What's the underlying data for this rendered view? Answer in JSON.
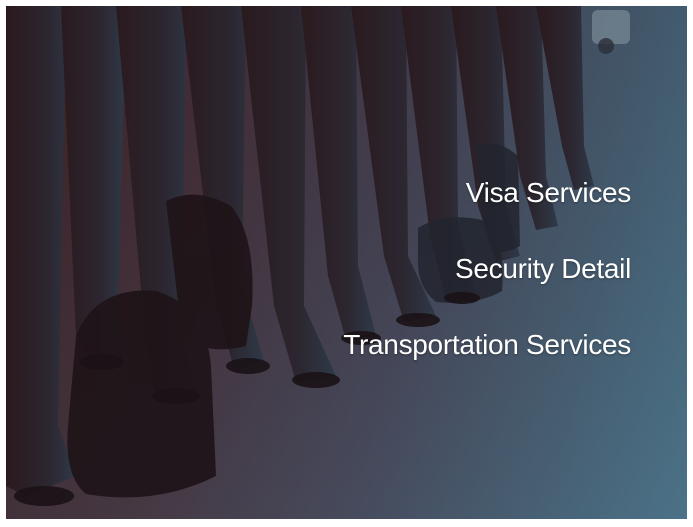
{
  "hero": {
    "image_icon": "soldiers-lineup-photo",
    "overlay_color_left": "#3a2226",
    "overlay_color_right": "#3f6a80"
  },
  "services": {
    "items": [
      {
        "label": "Visa Services"
      },
      {
        "label": "Security Detail"
      },
      {
        "label": "Transportation Services"
      }
    ],
    "text_color": "#ffffff"
  }
}
